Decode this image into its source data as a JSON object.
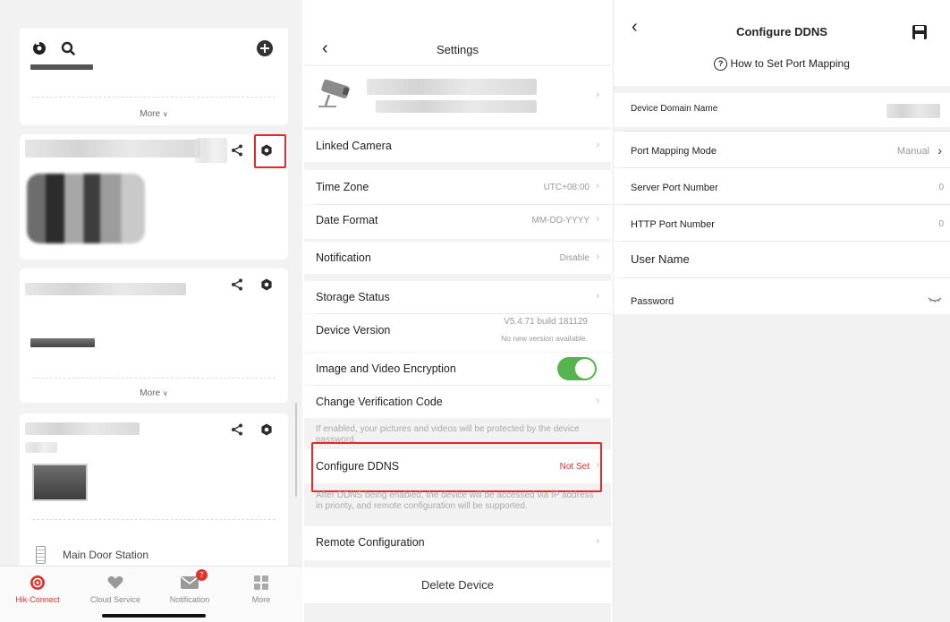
{
  "device_list": {
    "cards": [
      {
        "more_label": "More"
      },
      {},
      {
        "more_label": "More"
      },
      {
        "station_label": "Main Door Station"
      }
    ],
    "tabs": [
      {
        "label": "Hik-Connect",
        "icon": "hik-connect-icon",
        "active": true
      },
      {
        "label": "Cloud Service",
        "icon": "heart-icon",
        "active": false
      },
      {
        "label": "Notification",
        "icon": "envelope-icon",
        "active": false,
        "badge": "7"
      },
      {
        "label": "More",
        "icon": "grid-icon",
        "active": false
      }
    ]
  },
  "settings": {
    "title": "Settings",
    "rows": {
      "linked_camera": "Linked Camera",
      "time_zone": {
        "label": "Time Zone",
        "value": "UTC+08:00"
      },
      "date_format": {
        "label": "Date Format",
        "value": "MM-DD-YYYY"
      },
      "notification": {
        "label": "Notification",
        "value": "Disable"
      },
      "storage_status": "Storage Status",
      "device_version": {
        "label": "Device Version",
        "value": "V5.4.71 build 181129",
        "sub": "No new version available."
      },
      "encryption": {
        "label": "Image and Video Encryption",
        "enabled": true
      },
      "verification_code": "Change Verification Code",
      "encryption_note": "If enabled, your pictures and videos will be protected by the device password.",
      "ddns": {
        "label": "Configure DDNS",
        "value": "Not Set"
      },
      "ddns_note": "After DDNS being enabled, the device will be accessed via IP address in priority, and remote configuration will be supported.",
      "remote_configuration": "Remote Configuration",
      "delete_device": "Delete Device"
    }
  },
  "ddns": {
    "title": "Configure DDNS",
    "help_link": "How to Set Port Mapping",
    "rows": {
      "domain_name": {
        "label": "Device Domain Name"
      },
      "port_mapping_mode": {
        "label": "Port Mapping Mode",
        "value": "Manual"
      },
      "server_port": {
        "label": "Server Port Number",
        "value": "0"
      },
      "http_port": {
        "label": "HTTP Port Number",
        "value": "0"
      },
      "user_name": {
        "label": "User Name"
      },
      "password": {
        "label": "Password"
      }
    }
  },
  "colors": {
    "accent_red": "#e2322d",
    "toggle_green": "#56b44f",
    "highlight_red": "#e8272a"
  }
}
